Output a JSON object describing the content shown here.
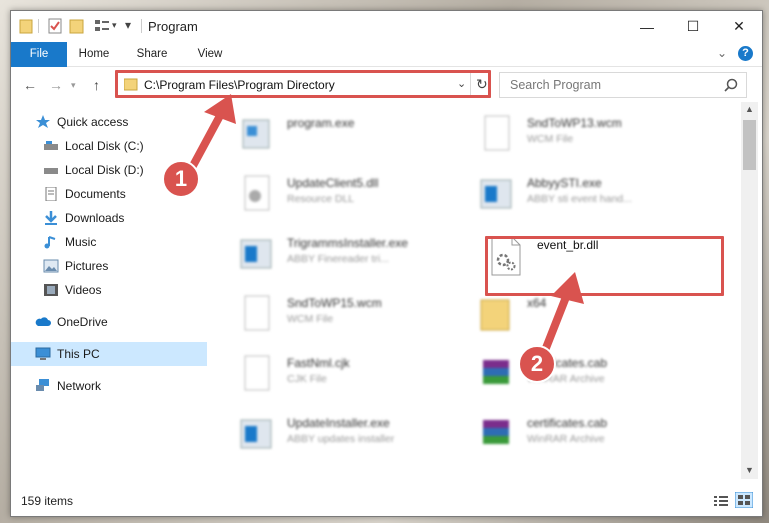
{
  "window": {
    "title": "Program",
    "controls": {
      "minimize": "—",
      "maximize": "☐",
      "close": "✕"
    }
  },
  "ribbon": {
    "tabs": [
      "File",
      "Home",
      "Share",
      "View"
    ],
    "help": "?"
  },
  "nav": {
    "address": "C:\\Program Files\\Program Directory",
    "search_placeholder": "Search Program"
  },
  "sidebar": {
    "items": [
      {
        "label": "Quick access",
        "icon": "star-icon"
      },
      {
        "label": "Local Disk (C:)",
        "icon": "drive-icon"
      },
      {
        "label": "Local Disk (D:)",
        "icon": "drive-icon"
      },
      {
        "label": "Documents",
        "icon": "documents-icon"
      },
      {
        "label": "Downloads",
        "icon": "download-icon"
      },
      {
        "label": "Music",
        "icon": "music-icon"
      },
      {
        "label": "Pictures",
        "icon": "pictures-icon"
      },
      {
        "label": "Videos",
        "icon": "videos-icon"
      },
      {
        "label": "OneDrive",
        "icon": "cloud-icon"
      },
      {
        "label": "This PC",
        "icon": "computer-icon"
      },
      {
        "label": "Network",
        "icon": "network-icon"
      }
    ]
  },
  "files": [
    {
      "name": "program.exe",
      "sub": ""
    },
    {
      "name": "SndToWP13.wcm",
      "sub": "WCM File"
    },
    {
      "name": "UpdateClient5.dll",
      "sub": "Resource DLL"
    },
    {
      "name": "AbbyySTI.exe",
      "sub": "ABBY sti event hand..."
    },
    {
      "name": "TrigrammsInstaller.exe",
      "sub": "ABBY Finereader tri..."
    },
    {
      "name": "event_br.dll",
      "sub": ""
    },
    {
      "name": "SndToWP15.wcm",
      "sub": "WCM File"
    },
    {
      "name": "x64",
      "sub": ""
    },
    {
      "name": "FastNml.cjk",
      "sub": "CJK File"
    },
    {
      "name": "certificates.cab",
      "sub": "WinRAR Archive"
    },
    {
      "name": "UpdateInstaller.exe",
      "sub": "ABBY updates installer"
    },
    {
      "name": "certificates.cab",
      "sub": "WinRAR Archive"
    }
  ],
  "status": {
    "count": "159 items"
  },
  "callouts": {
    "one": "1",
    "two": "2"
  },
  "colors": {
    "accent": "#1979ca",
    "highlight": "#d9534f",
    "selected": "#cce8ff"
  }
}
